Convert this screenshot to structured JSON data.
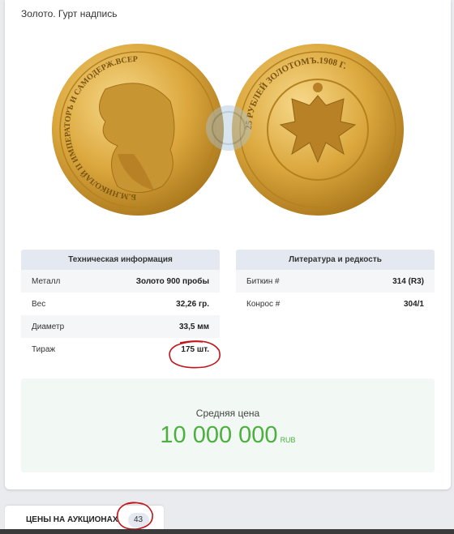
{
  "lot": {
    "caption": "Золото. Гурт надпись"
  },
  "coin": {
    "obverse_legend": "Б.М.НИКОЛАЙ II ИМПЕРАТОРЪ И САМОДЕРЖ.ВСЕРОСС.",
    "reverse_legend": "25 РУБЛЕЙ ЗОЛОТОМЪ.1908 Г."
  },
  "tech": {
    "title": "Техническая информация",
    "rows": [
      {
        "label": "Металл",
        "value": "Золото 900 пробы"
      },
      {
        "label": "Вес",
        "value": "32,26 гр."
      },
      {
        "label": "Диаметр",
        "value": "33,5 мм"
      },
      {
        "label": "Тираж",
        "value": "175 шт."
      }
    ]
  },
  "lit": {
    "title": "Литература и редкость",
    "rows": [
      {
        "label": "Биткин #",
        "value": "314 (R3)"
      },
      {
        "label": "Конрос #",
        "value": "304/1"
      }
    ]
  },
  "price": {
    "label": "Средняя цена",
    "value": "10 000 000",
    "currency": "RUB"
  },
  "tabs": {
    "auctions_label": "ЦЕНЫ НА АУКЦИОНАХ",
    "auctions_count": "43"
  },
  "colors": {
    "accent": "#4caf3f",
    "panel_head": "#e4e9f1",
    "gold": "#d9a53a",
    "annotation": "#c0151b"
  }
}
